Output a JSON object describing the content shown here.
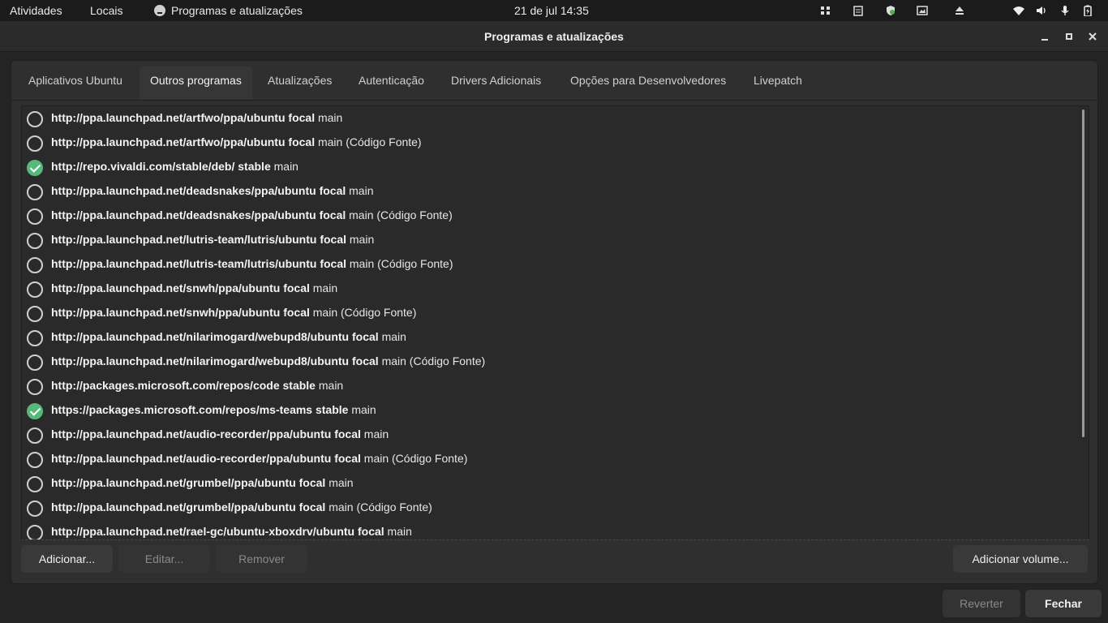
{
  "topbar": {
    "activities": "Atividades",
    "places": "Locais",
    "app_name": "Programas e atualizações",
    "clock": "21 de jul  14:35",
    "tray_icons": [
      "grid-icon",
      "clipboard-icon",
      "shield-icon",
      "image-icon",
      "eject-icon",
      "wifi-icon",
      "volume-icon",
      "microphone-icon",
      "battery-icon"
    ]
  },
  "window": {
    "title": "Programas e atualizações",
    "controls": [
      "minimize",
      "maximize",
      "close"
    ]
  },
  "tabs": [
    {
      "label": "Aplicativos Ubuntu",
      "active": false
    },
    {
      "label": "Outros programas",
      "active": true
    },
    {
      "label": "Atualizações",
      "active": false
    },
    {
      "label": "Autenticação",
      "active": false
    },
    {
      "label": "Drivers Adicionais",
      "active": false
    },
    {
      "label": "Opções para Desenvolvedores",
      "active": false
    },
    {
      "label": "Livepatch",
      "active": false
    }
  ],
  "sources": [
    {
      "checked": false,
      "url": "http://ppa.launchpad.net/artfwo/ppa/ubuntu focal",
      "rest": "main"
    },
    {
      "checked": false,
      "url": "http://ppa.launchpad.net/artfwo/ppa/ubuntu focal",
      "rest": "main (Código Fonte)"
    },
    {
      "checked": true,
      "url": "http://repo.vivaldi.com/stable/deb/ stable",
      "rest": "main"
    },
    {
      "checked": false,
      "url": "http://ppa.launchpad.net/deadsnakes/ppa/ubuntu focal",
      "rest": "main"
    },
    {
      "checked": false,
      "url": "http://ppa.launchpad.net/deadsnakes/ppa/ubuntu focal",
      "rest": "main (Código Fonte)"
    },
    {
      "checked": false,
      "url": "http://ppa.launchpad.net/lutris-team/lutris/ubuntu focal",
      "rest": "main"
    },
    {
      "checked": false,
      "url": "http://ppa.launchpad.net/lutris-team/lutris/ubuntu focal",
      "rest": "main (Código Fonte)"
    },
    {
      "checked": false,
      "url": "http://ppa.launchpad.net/snwh/ppa/ubuntu focal",
      "rest": "main"
    },
    {
      "checked": false,
      "url": "http://ppa.launchpad.net/snwh/ppa/ubuntu focal",
      "rest": "main (Código Fonte)"
    },
    {
      "checked": false,
      "url": "http://ppa.launchpad.net/nilarimogard/webupd8/ubuntu focal",
      "rest": "main"
    },
    {
      "checked": false,
      "url": "http://ppa.launchpad.net/nilarimogard/webupd8/ubuntu focal",
      "rest": "main (Código Fonte)"
    },
    {
      "checked": false,
      "url": "http://packages.microsoft.com/repos/code stable",
      "rest": "main"
    },
    {
      "checked": true,
      "url": "https://packages.microsoft.com/repos/ms-teams stable",
      "rest": "main"
    },
    {
      "checked": false,
      "url": "http://ppa.launchpad.net/audio-recorder/ppa/ubuntu focal",
      "rest": "main"
    },
    {
      "checked": false,
      "url": "http://ppa.launchpad.net/audio-recorder/ppa/ubuntu focal",
      "rest": "main (Código Fonte)"
    },
    {
      "checked": false,
      "url": "http://ppa.launchpad.net/grumbel/ppa/ubuntu focal",
      "rest": "main"
    },
    {
      "checked": false,
      "url": "http://ppa.launchpad.net/grumbel/ppa/ubuntu focal",
      "rest": "main (Código Fonte)"
    },
    {
      "checked": false,
      "url": "http://ppa.launchpad.net/rael-gc/ubuntu-xboxdrv/ubuntu focal",
      "rest": "main"
    }
  ],
  "buttons": {
    "add": "Adicionar...",
    "edit": "Editar...",
    "remove": "Remover",
    "add_volume": "Adicionar volume...",
    "revert": "Reverter",
    "close": "Fechar"
  }
}
